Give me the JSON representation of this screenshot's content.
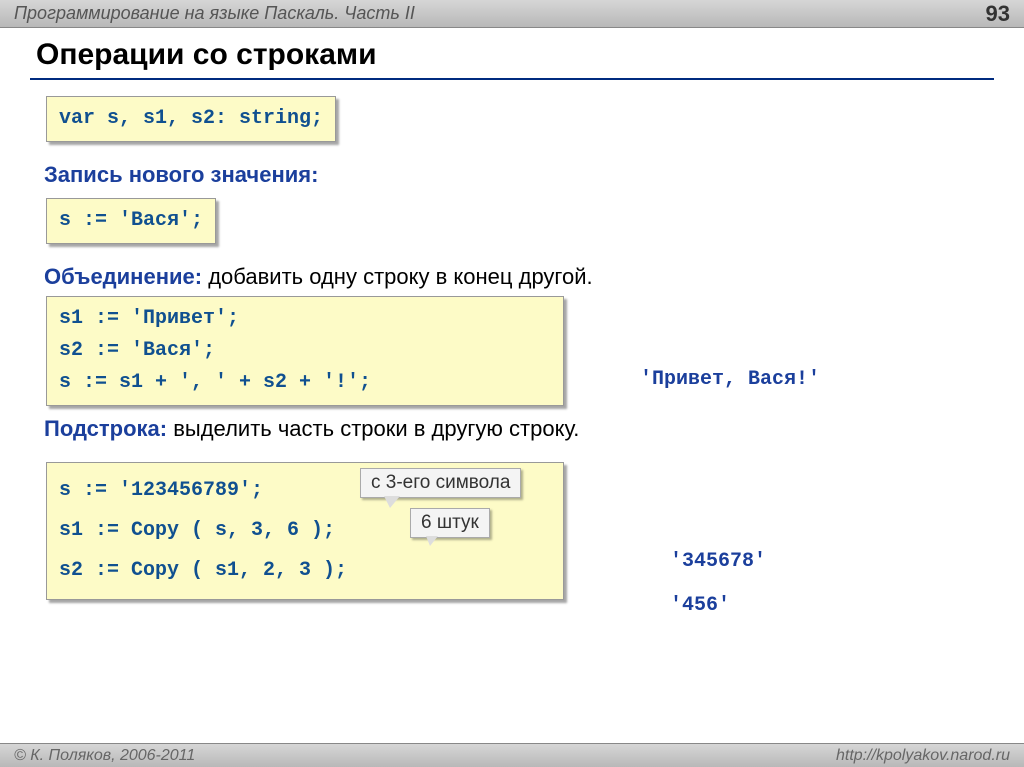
{
  "header": {
    "title": "Программирование на языке Паскаль. Часть II",
    "page": "93"
  },
  "title": "Операции со строками",
  "codebox1": "var s, s1, s2: string;",
  "section1": {
    "label": "Запись нового значения:"
  },
  "codebox2": "s := 'Вася';",
  "section2": {
    "label": "Объединение:",
    "text": " добавить одну строку в конец другой."
  },
  "codebox3": {
    "l1": "s1 := 'Привет';",
    "l2": "s2 := 'Вася';",
    "l3": "s := s1 + ', ' + s2 + '!';"
  },
  "result1": "'Привет, Вася!'",
  "section3": {
    "label": "Подстрока:",
    "text": " выделить часть строки в другую строку."
  },
  "codebox4": {
    "l1": "s := '123456789';",
    "l2": "s1 := Copy ( s, 3, 6 );",
    "l3": "s2 := Copy ( s1, 2, 3 );"
  },
  "callout1": "с 3-его символа",
  "callout2": "6 штук",
  "result2": "'345678'",
  "result3": "'456'",
  "footer": {
    "left": "© К. Поляков, 2006-2011",
    "right": "http://kpolyakov.narod.ru"
  }
}
